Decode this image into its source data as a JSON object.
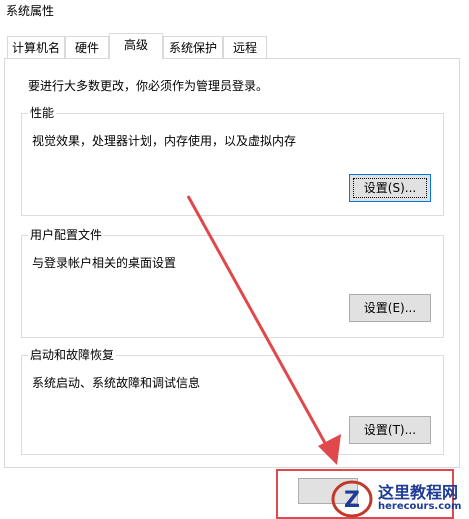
{
  "window": {
    "title": "系统属性"
  },
  "tabs": [
    {
      "label": "计算机名"
    },
    {
      "label": "硬件"
    },
    {
      "label": "高级",
      "selected": true
    },
    {
      "label": "系统保护"
    },
    {
      "label": "远程"
    }
  ],
  "notice": "要进行大多数更改，你必须作为管理员登录。",
  "groups": {
    "performance": {
      "label": "性能",
      "desc": "视觉效果，处理器计划，内存使用，以及虚拟内存",
      "button": "设置(S)..."
    },
    "profiles": {
      "label": "用户配置文件",
      "desc": "与登录帐户相关的桌面设置",
      "button": "设置(E)..."
    },
    "startup": {
      "label": "启动和故障恢复",
      "desc": "系统启动、系统故障和调试信息",
      "button": "设置(T)..."
    }
  },
  "watermark": {
    "title": "这里教程网",
    "url": "herecours.com",
    "icon": "z-logo-icon"
  },
  "annotation": {
    "color": "#e0484b",
    "arrow": "red-arrow"
  }
}
